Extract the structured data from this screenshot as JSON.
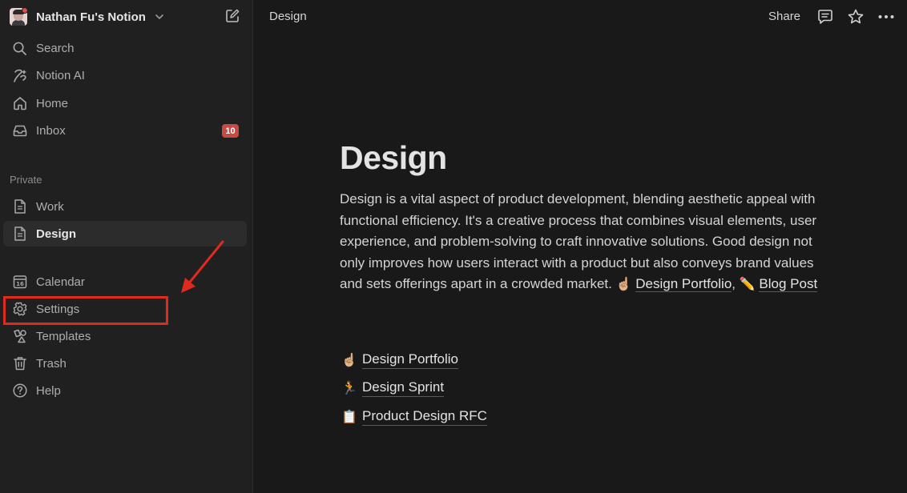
{
  "sidebar": {
    "workspace_name": "Nathan Fu's Notion",
    "nav": [
      {
        "label": "Search",
        "icon": "search-icon"
      },
      {
        "label": "Notion AI",
        "icon": "notion-ai-icon"
      },
      {
        "label": "Home",
        "icon": "home-icon"
      },
      {
        "label": "Inbox",
        "icon": "inbox-icon",
        "badge": "10"
      }
    ],
    "section_private": "Private",
    "private_pages": [
      {
        "label": "Work",
        "icon": "page-icon"
      },
      {
        "label": "Design",
        "icon": "page-icon",
        "active": true
      }
    ],
    "footer": [
      {
        "label": "Calendar",
        "icon": "calendar-icon",
        "icon_text": "16"
      },
      {
        "label": "Settings",
        "icon": "gear-icon"
      },
      {
        "label": "Templates",
        "icon": "templates-icon"
      },
      {
        "label": "Trash",
        "icon": "trash-icon"
      },
      {
        "label": "Help",
        "icon": "help-icon"
      }
    ]
  },
  "topbar": {
    "breadcrumb": "Design",
    "share_label": "Share"
  },
  "page": {
    "title": "Design",
    "body_text": "Design is a vital aspect of product development, blending aesthetic appeal with functional efficiency. It's a creative process that combines visual elements, user experience, and problem-solving to craft innovative solutions. Good design not only improves how users interact with a product but also conveys brand values and sets offerings apart in a crowded market.",
    "inline_links": [
      {
        "emoji": "☝🏼",
        "label": "Design Portfolio"
      },
      {
        "emoji": "✏️",
        "label": "Blog Post"
      }
    ],
    "separator": ",",
    "sub_pages": [
      {
        "emoji": "☝🏼",
        "label": "Design Portfolio"
      },
      {
        "emoji": "🏃",
        "label": "Design Sprint"
      },
      {
        "emoji": "📋",
        "label": "Product Design RFC"
      }
    ]
  },
  "colors": {
    "sidebar_bg": "#202020",
    "page_bg": "#191919",
    "badge": "#c94a45",
    "annotation": "#e02a1e"
  }
}
